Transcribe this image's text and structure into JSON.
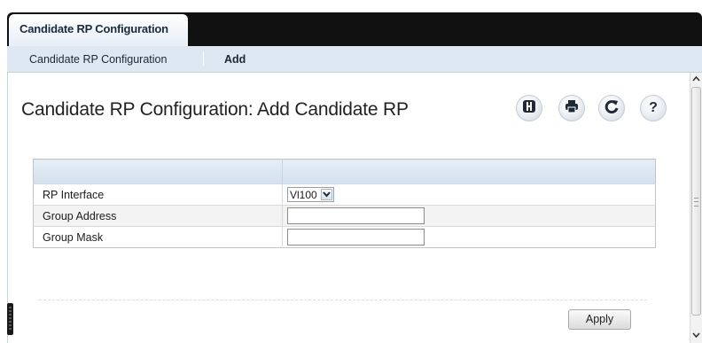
{
  "tab": {
    "label": "Candidate RP Configuration"
  },
  "breadcrumb": {
    "parent": "Candidate RP Configuration",
    "current": "Add"
  },
  "page": {
    "title": "Candidate RP Configuration: Add Candidate RP"
  },
  "toolbar": {
    "icons": [
      "save-icon",
      "print-icon",
      "refresh-icon",
      "help-icon"
    ]
  },
  "form": {
    "rows": [
      {
        "label": "RP Interface",
        "type": "select",
        "value": "Vl100"
      },
      {
        "label": "Group Address",
        "type": "text",
        "value": ""
      },
      {
        "label": "Group Mask",
        "type": "text",
        "value": ""
      }
    ]
  },
  "actions": {
    "apply_label": "Apply"
  },
  "colors": {
    "top_bar": "#111111",
    "subnav_bg": "#dde8f3",
    "table_header": "#d3e0ed",
    "icon_dark": "#1f2a36"
  }
}
